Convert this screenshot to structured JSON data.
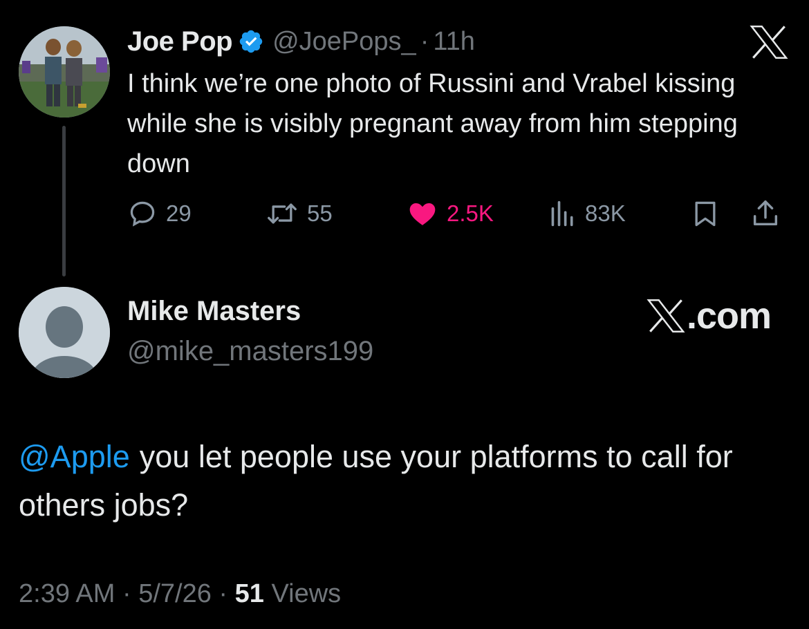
{
  "quoted_tweet": {
    "author_name": "Joe Pop",
    "handle": "@JoePops_",
    "separator": "·",
    "time": "11h",
    "text": "I think we’re one photo of Russini and Vrabel kissing while she is visibly pregnant away from him stepping down",
    "verified_color": "#1d9bf0",
    "actions": {
      "replies": "29",
      "retweets": "55",
      "likes": "2.5K",
      "views": "83K"
    },
    "like_color": "#f91880"
  },
  "watermark": {
    "text": ".com"
  },
  "reply_tweet": {
    "author_name": "Mike Masters",
    "handle": "@mike_masters199",
    "mention": "@Apple",
    "text": "you let people use your platforms to call for others jobs?",
    "mention_color": "#1d9bf0",
    "time": "2:39 AM",
    "separator": "·",
    "date": "5/7/26",
    "views_count": "51",
    "views_label": "Views"
  }
}
